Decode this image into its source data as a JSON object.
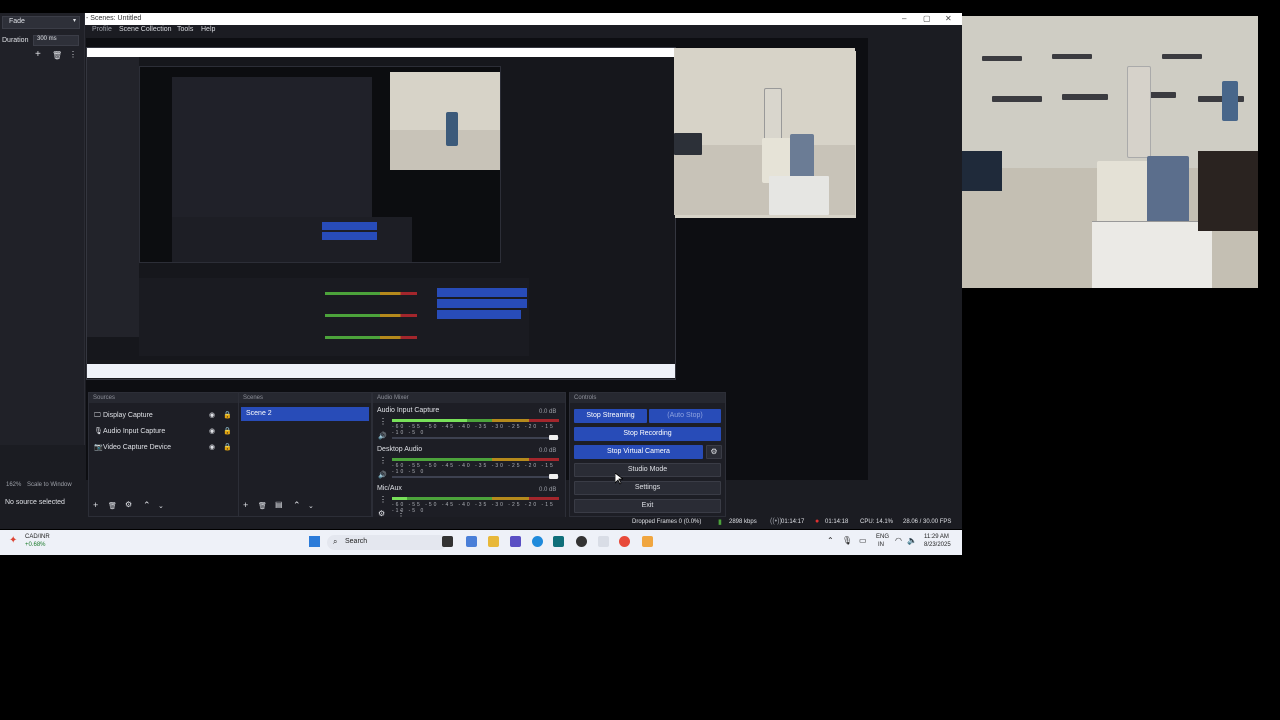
{
  "window": {
    "title": "- Scenes: Untitled"
  },
  "menu": [
    "Profile",
    "Scene Collection",
    "Tools",
    "Help"
  ],
  "transition": {
    "selected": "Fade",
    "duration_label": "Duration",
    "duration_value": "300 ms"
  },
  "sources": {
    "items": [
      "Display Capture",
      "Audio Input Capture",
      "Video Capture Device"
    ]
  },
  "scenes": {
    "items": [
      "Scene 2"
    ]
  },
  "mixer": {
    "channels": [
      {
        "name": "Audio Input Capture",
        "db": "0.0 dB",
        "level": 0.45
      },
      {
        "name": "Desktop Audio",
        "db": "0.0 dB",
        "level": 0.0
      },
      {
        "name": "Mic/Aux",
        "db": "0.0 dB",
        "level": 0.09
      }
    ],
    "tick_labels": "-60 -55 -50 -45 -40 -35 -30 -25 -20 -15 -10 -5 0"
  },
  "controls": {
    "stop_streaming": "Stop Streaming",
    "auto_stop": "(Auto Stop)",
    "stop_recording": "Stop Recording",
    "stop_virtual_camera": "Stop Virtual Camera",
    "studio_mode": "Studio Mode",
    "settings": "Settings",
    "exit": "Exit"
  },
  "left_status": {
    "zoom": "162%",
    "scale": "Scale to Window",
    "no_source": "No source selected"
  },
  "status": {
    "dropped": "Dropped Frames 0 (0.0%)",
    "bitrate": "2898 kbps",
    "stream_time": "01:14:17",
    "rec_time": "01:14:18",
    "cpu": "CPU: 14.1%",
    "fps": "28.06 / 30.00 FPS"
  },
  "taskbar": {
    "ticker": "CAD/INR",
    "ticker_change": "+0.68%",
    "search": "Search",
    "lang1": "ENG",
    "lang2": "IN",
    "time": "11:29 AM",
    "date": "8/23/2025"
  },
  "colors": {
    "accent": "#284cb8",
    "obs_bg": "#1b1c22",
    "record_red": "#e03030"
  }
}
